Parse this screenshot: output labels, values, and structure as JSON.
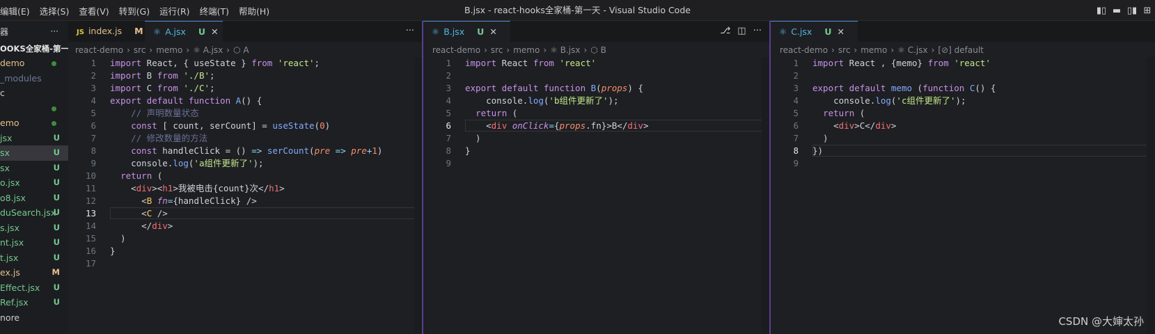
{
  "menu": [
    "编辑(E)",
    "选择(S)",
    "查看(V)",
    "转到(G)",
    "运行(R)",
    "终端(T)",
    "帮助(H)"
  ],
  "window_title": "B.jsx - react-hooks全家桶-第一天 - Visual Studio Code",
  "layout_icons": [
    "▮▯",
    "▬",
    "▯▮",
    "⊞"
  ],
  "sidebar": {
    "title": "器",
    "more": "···",
    "project": "OOKS全家桶-第一天",
    "items": [
      {
        "label": "demo",
        "color": "#e2c08d",
        "badge": "",
        "dot": true
      },
      {
        "label": "_modules",
        "color": "#6a7a9a",
        "badge": "",
        "dot": false
      },
      {
        "label": "c",
        "color": "#cccccc",
        "badge": "",
        "dot": false
      },
      {
        "label": "",
        "color": "#cccccc",
        "badge": "",
        "dot": true
      },
      {
        "label": "emo",
        "color": "#e2c08d",
        "badge": "",
        "dot": true
      },
      {
        "label": "jsx",
        "color": "#73c991",
        "badge": "U",
        "dot": false
      },
      {
        "label": "sx",
        "color": "#73c991",
        "badge": "U",
        "dot": false,
        "selected": true
      },
      {
        "label": "sx",
        "color": "#73c991",
        "badge": "U",
        "dot": false
      },
      {
        "label": "o.jsx",
        "color": "#73c991",
        "badge": "U",
        "dot": false
      },
      {
        "label": "o8.jsx",
        "color": "#73c991",
        "badge": "U",
        "dot": false
      },
      {
        "label": "duSearch.jsx",
        "color": "#73c991",
        "badge": "U",
        "dot": false
      },
      {
        "label": "s.jsx",
        "color": "#73c991",
        "badge": "U",
        "dot": false
      },
      {
        "label": "nt.jsx",
        "color": "#73c991",
        "badge": "U",
        "dot": false
      },
      {
        "label": "t.jsx",
        "color": "#73c991",
        "badge": "U",
        "dot": false
      },
      {
        "label": "ex.js",
        "color": "#e2c08d",
        "badge": "M",
        "dot": false
      },
      {
        "label": "Effect.jsx",
        "color": "#73c991",
        "badge": "U",
        "dot": false
      },
      {
        "label": "Ref.jsx",
        "color": "#73c991",
        "badge": "U",
        "dot": false
      },
      {
        "label": "nore",
        "color": "#cccccc",
        "badge": "",
        "dot": false
      }
    ]
  },
  "panes": [
    {
      "tabs": [
        {
          "icon": "JS",
          "label": "index.js",
          "status": "M",
          "status_color": "#e2c08d",
          "active": false
        },
        {
          "icon": "react",
          "label": "A.jsx",
          "status": "U",
          "status_color": "#73c991",
          "active": true,
          "close": "✕"
        }
      ],
      "actions": [
        "···"
      ],
      "breadcrumb": [
        "react-demo",
        "src",
        "memo",
        "A.jsx",
        "A"
      ],
      "current_line": 13,
      "lines": [
        [
          [
            "kw",
            "import"
          ],
          [
            "var",
            " React, { useState } "
          ],
          [
            "kw",
            "from"
          ],
          [
            "var",
            " "
          ],
          [
            "str",
            "'react'"
          ],
          [
            "var",
            ";"
          ]
        ],
        [
          [
            "kw",
            "import"
          ],
          [
            "var",
            " B "
          ],
          [
            "kw",
            "from"
          ],
          [
            "var",
            " "
          ],
          [
            "str",
            "'./B'"
          ],
          [
            "var",
            ";"
          ]
        ],
        [
          [
            "kw",
            "import"
          ],
          [
            "var",
            " C "
          ],
          [
            "kw",
            "from"
          ],
          [
            "var",
            " "
          ],
          [
            "str",
            "'./C'"
          ],
          [
            "var",
            ";"
          ]
        ],
        [
          [
            "kw",
            "export default function"
          ],
          [
            "var",
            " "
          ],
          [
            "fn",
            "A"
          ],
          [
            "var",
            "() {"
          ]
        ],
        [
          [
            "var",
            "    "
          ],
          [
            "com",
            "// 声明数量状态"
          ]
        ],
        [
          [
            "var",
            "    "
          ],
          [
            "kw",
            "const"
          ],
          [
            "var",
            " [ count, serCount] = "
          ],
          [
            "fn",
            "useState"
          ],
          [
            "var",
            "("
          ],
          [
            "num",
            "0"
          ],
          [
            "var",
            ")"
          ]
        ],
        [
          [
            "var",
            "    "
          ],
          [
            "com",
            "// 修改数量的方法"
          ]
        ],
        [
          [
            "var",
            "    "
          ],
          [
            "kw",
            "const"
          ],
          [
            "var",
            " handleClick = () "
          ],
          [
            "op",
            "=>"
          ],
          [
            "var",
            " "
          ],
          [
            "fn",
            "serCount"
          ],
          [
            "var",
            "("
          ],
          [
            "prm",
            "pre"
          ],
          [
            "var",
            " "
          ],
          [
            "op",
            "=>"
          ],
          [
            "var",
            " "
          ],
          [
            "prm",
            "pre"
          ],
          [
            "op",
            "+"
          ],
          [
            "num",
            "1"
          ],
          [
            "var",
            ")"
          ]
        ],
        [
          [
            "var",
            "    console."
          ],
          [
            "fn",
            "log"
          ],
          [
            "var",
            "("
          ],
          [
            "str",
            "'a组件更新了'"
          ],
          [
            "var",
            ");"
          ]
        ],
        [
          [
            "var",
            "  "
          ],
          [
            "kw",
            "return"
          ],
          [
            "var",
            " ("
          ]
        ],
        [
          [
            "var",
            "    <"
          ],
          [
            "tag",
            "div"
          ],
          [
            "var",
            "><"
          ],
          [
            "tag",
            "h1"
          ],
          [
            "var",
            ">我被电击{count}次</"
          ],
          [
            "tag",
            "h1"
          ],
          [
            "var",
            ">"
          ]
        ],
        [
          [
            "var",
            "      <"
          ],
          [
            "br",
            "B"
          ],
          [
            "var",
            " "
          ],
          [
            "attr",
            "fn"
          ],
          [
            "op",
            "="
          ],
          [
            "var",
            "{handleClick} />"
          ]
        ],
        [
          [
            "var",
            "      <"
          ],
          [
            "br",
            "C"
          ],
          [
            "var",
            " />"
          ]
        ],
        [
          [
            "var",
            "      </"
          ],
          [
            "tag",
            "div"
          ],
          [
            "var",
            ">"
          ]
        ],
        [
          [
            "var",
            "  )"
          ]
        ],
        [
          [
            "var",
            "}"
          ]
        ],
        []
      ]
    },
    {
      "tabs": [
        {
          "icon": "react",
          "label": "B.jsx",
          "status": "U",
          "status_color": "#73c991",
          "active": true,
          "close": "✕"
        }
      ],
      "actions": [
        "⎇",
        "◫",
        "···"
      ],
      "breadcrumb": [
        "react-demo",
        "src",
        "memo",
        "B.jsx",
        "B"
      ],
      "current_line": 6,
      "lines": [
        [
          [
            "kw",
            "import"
          ],
          [
            "var",
            " React "
          ],
          [
            "kw",
            "from"
          ],
          [
            "var",
            " "
          ],
          [
            "str",
            "'react'"
          ]
        ],
        [],
        [
          [
            "kw",
            "export default function"
          ],
          [
            "var",
            " "
          ],
          [
            "fn",
            "B"
          ],
          [
            "var",
            "("
          ],
          [
            "prm",
            "props"
          ],
          [
            "var",
            ") {"
          ]
        ],
        [
          [
            "var",
            "    console."
          ],
          [
            "fn",
            "log"
          ],
          [
            "var",
            "("
          ],
          [
            "str",
            "'b组件更新了'"
          ],
          [
            "var",
            ");"
          ]
        ],
        [
          [
            "var",
            "  "
          ],
          [
            "kw",
            "return"
          ],
          [
            "var",
            " ("
          ]
        ],
        [
          [
            "var",
            "    <"
          ],
          [
            "tag",
            "div"
          ],
          [
            "var",
            " "
          ],
          [
            "attr",
            "onClick"
          ],
          [
            "op",
            "="
          ],
          [
            "var",
            "{"
          ],
          [
            "prm",
            "props"
          ],
          [
            "var",
            ".fn}>B</"
          ],
          [
            "tag",
            "div"
          ],
          [
            "var",
            ">"
          ]
        ],
        [
          [
            "var",
            "  )"
          ]
        ],
        [
          [
            "var",
            "}"
          ]
        ],
        []
      ]
    },
    {
      "tabs": [
        {
          "icon": "react",
          "label": "C.jsx",
          "status": "U",
          "status_color": "#73c991",
          "active": true,
          "close": "✕"
        }
      ],
      "actions": [],
      "breadcrumb": [
        "react-demo",
        "src",
        "memo",
        "C.jsx",
        "[⊘] default"
      ],
      "current_line": 8,
      "lines": [
        [
          [
            "kw",
            "import"
          ],
          [
            "var",
            " React , {memo} "
          ],
          [
            "kw",
            "from"
          ],
          [
            "var",
            " "
          ],
          [
            "str",
            "'react'"
          ]
        ],
        [],
        [
          [
            "kw",
            "export default"
          ],
          [
            "var",
            " "
          ],
          [
            "fn",
            "memo"
          ],
          [
            "var",
            " ("
          ],
          [
            "kw",
            "function"
          ],
          [
            "var",
            " "
          ],
          [
            "fn",
            "C"
          ],
          [
            "var",
            "() {"
          ]
        ],
        [
          [
            "var",
            "    console."
          ],
          [
            "fn",
            "log"
          ],
          [
            "var",
            "("
          ],
          [
            "str",
            "'c组件更新了'"
          ],
          [
            "var",
            ");"
          ]
        ],
        [
          [
            "var",
            "  "
          ],
          [
            "kw",
            "return"
          ],
          [
            "var",
            " ("
          ]
        ],
        [
          [
            "var",
            "    <"
          ],
          [
            "tag",
            "div"
          ],
          [
            "var",
            ">C</"
          ],
          [
            "tag",
            "div"
          ],
          [
            "var",
            ">"
          ]
        ],
        [
          [
            "var",
            "  )"
          ]
        ],
        [
          [
            "var",
            "})"
          ]
        ],
        []
      ]
    }
  ],
  "watermark": "CSDN @大婶太孙"
}
